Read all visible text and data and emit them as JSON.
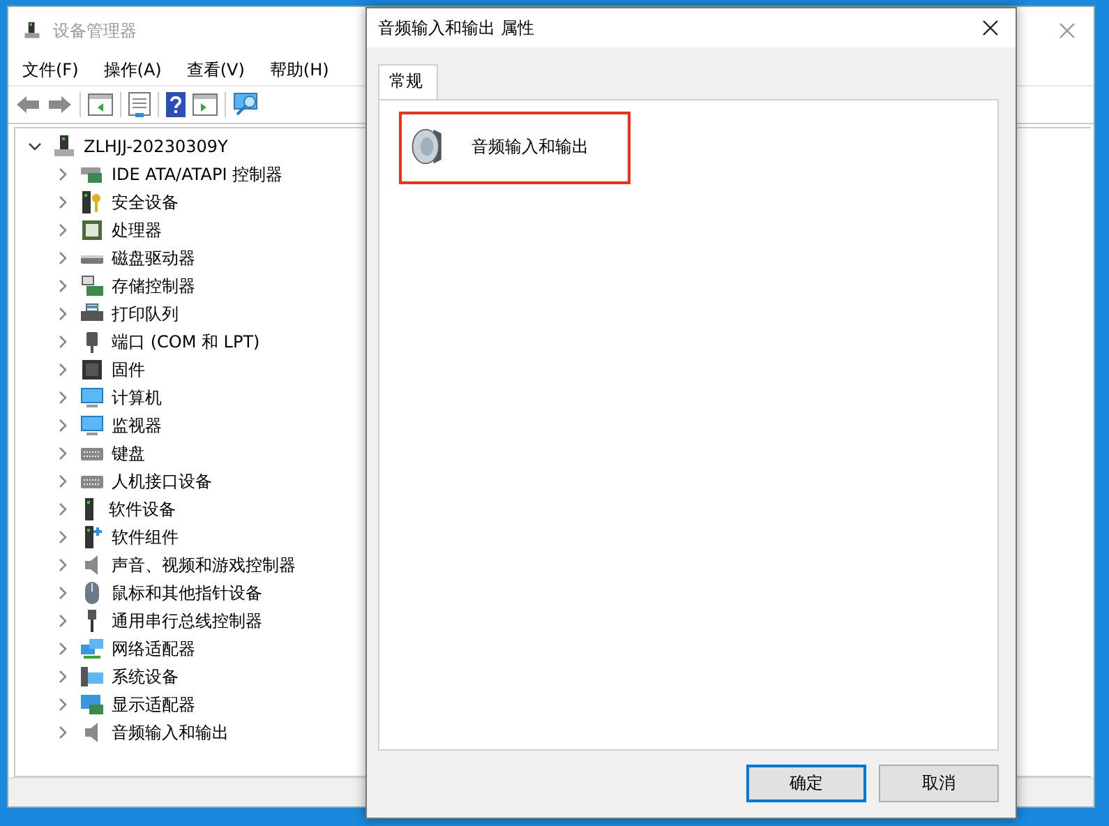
{
  "main_window": {
    "title": "设备管理器",
    "menu": [
      {
        "label": "文件(F)"
      },
      {
        "label": "操作(A)"
      },
      {
        "label": "查看(V)"
      },
      {
        "label": "帮助(H)"
      }
    ],
    "tree": {
      "label": "ZLHJJ-20230309Y",
      "expanded": true,
      "children": [
        {
          "label": "IDE ATA/ATAPI 控制器",
          "expanded": false
        },
        {
          "label": "安全设备",
          "expanded": false
        },
        {
          "label": "处理器",
          "expanded": false
        },
        {
          "label": "磁盘驱动器",
          "expanded": false
        },
        {
          "label": "存储控制器",
          "expanded": false
        },
        {
          "label": "打印队列",
          "expanded": false
        },
        {
          "label": "端口 (COM 和 LPT)",
          "expanded": false
        },
        {
          "label": "固件",
          "expanded": false
        },
        {
          "label": "计算机",
          "expanded": false
        },
        {
          "label": "监视器",
          "expanded": false
        },
        {
          "label": "键盘",
          "expanded": false
        },
        {
          "label": "人机接口设备",
          "expanded": false
        },
        {
          "label": "软件设备",
          "expanded": false
        },
        {
          "label": "软件组件",
          "expanded": false
        },
        {
          "label": "声音、视频和游戏控制器",
          "expanded": false
        },
        {
          "label": "鼠标和其他指针设备",
          "expanded": false
        },
        {
          "label": "通用串行总线控制器",
          "expanded": false
        },
        {
          "label": "网络适配器",
          "expanded": false
        },
        {
          "label": "系统设备",
          "expanded": false
        },
        {
          "label": "显示适配器",
          "expanded": false
        },
        {
          "label": "音频输入和输出",
          "expanded": false
        }
      ]
    }
  },
  "dialog": {
    "title": "音频输入和输出 属性",
    "tabs": [
      {
        "label": "常规",
        "selected": true
      }
    ],
    "device": {
      "name": "音频输入和输出",
      "highlighted": true
    },
    "buttons": [
      {
        "label": "确定",
        "default": true
      },
      {
        "label": "取消",
        "default": false
      }
    ]
  }
}
